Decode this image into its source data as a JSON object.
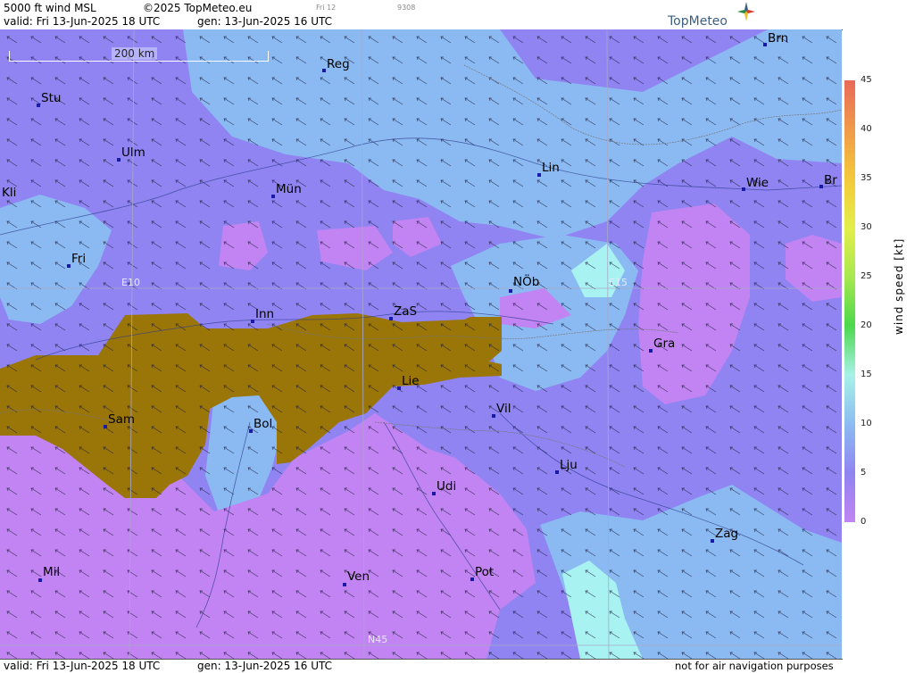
{
  "header": {
    "title": "5000 ft wind MSL",
    "copyright": "©2025 TopMeteo.eu",
    "valid_label": "valid:  Fri  13-Jun-2025  18 UTC",
    "gen_label": "gen: 13-Jun-2025 16 UTC",
    "tiny_left": "Fri 12",
    "tiny_right": "9308",
    "brand": "TopMeteo"
  },
  "footer": {
    "valid_label": "valid:  Fri  13-Jun-2025  18 UTC",
    "gen_label": "gen: 13-Jun-2025 16 UTC",
    "disclaimer": "not for air navigation purposes"
  },
  "map": {
    "scale_label": "200 km",
    "grid_labels": [
      "E10",
      "E15",
      "N45"
    ],
    "cities": [
      {
        "name": "Brn"
      },
      {
        "name": "Reg"
      },
      {
        "name": "Stu"
      },
      {
        "name": "Ulm"
      },
      {
        "name": "Lin"
      },
      {
        "name": "Wie"
      },
      {
        "name": "Br"
      },
      {
        "name": "Kli"
      },
      {
        "name": "Mün"
      },
      {
        "name": "Fri"
      },
      {
        "name": "NÖb"
      },
      {
        "name": "Inn"
      },
      {
        "name": "ZaS"
      },
      {
        "name": "Gra"
      },
      {
        "name": "Lie"
      },
      {
        "name": "Vil"
      },
      {
        "name": "Sam"
      },
      {
        "name": "Bol"
      },
      {
        "name": "Lju"
      },
      {
        "name": "Udi"
      },
      {
        "name": "Zag"
      },
      {
        "name": "Mil"
      },
      {
        "name": "Pot"
      },
      {
        "name": "Ven"
      }
    ],
    "colors": {
      "calm": "#c184f2",
      "light": "#8f84f2",
      "moderate": "#8bbaf2",
      "fresh": "#a9f2f2",
      "terrain": "#9a7508"
    }
  },
  "legend": {
    "title": "wind speed [kt]",
    "ticks": [
      "45",
      "40",
      "35",
      "30",
      "25",
      "20",
      "15",
      "10",
      "5",
      "0"
    ],
    "colors": [
      "#e86a5a",
      "#f09a4a",
      "#f4c83a",
      "#e4ee4a",
      "#a8e850",
      "#4cd84c",
      "#a8f2e8",
      "#8cbcf2",
      "#8f84f2",
      "#c184f2"
    ]
  }
}
